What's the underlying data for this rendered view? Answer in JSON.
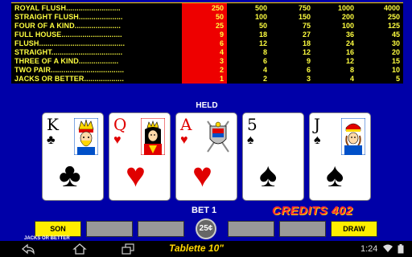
{
  "paytable": {
    "hands": [
      "ROYAL FLUSH",
      "STRAIGHT FLUSH",
      "FOUR OF A KIND",
      "FULL HOUSE",
      "FLUSH",
      "STRAIGHT",
      "THREE OF A KIND",
      "TWO PAIR",
      "JACKS OR BETTER"
    ],
    "dotted_names": [
      "ROYAL FLUSH..........................",
      "STRAIGHT FLUSH.....................",
      "FOUR OF A KIND......................",
      "FULL HOUSE.............................",
      "FLUSH.........................................",
      "STRAIGHT..................................",
      "THREE OF A KIND...................",
      "TWO PAIR...................................",
      "JACKS OR BETTER..................."
    ],
    "columns": [
      {
        "values": [
          "250",
          "50",
          "25",
          "9",
          "6",
          "4",
          "3",
          "2",
          "1"
        ],
        "highlighted": true
      },
      {
        "values": [
          "500",
          "100",
          "50",
          "18",
          "12",
          "8",
          "6",
          "4",
          "2"
        ],
        "highlighted": false
      },
      {
        "values": [
          "750",
          "150",
          "75",
          "27",
          "18",
          "12",
          "9",
          "6",
          "3"
        ],
        "highlighted": false
      },
      {
        "values": [
          "1000",
          "200",
          "100",
          "36",
          "24",
          "16",
          "12",
          "8",
          "4"
        ],
        "highlighted": false
      },
      {
        "values": [
          "4000",
          "250",
          "125",
          "45",
          "30",
          "20",
          "15",
          "10",
          "5"
        ],
        "highlighted": false
      }
    ],
    "highlight_color": "#ee0000",
    "text_color": "#ffff40"
  },
  "held_label": "HELD",
  "cards": [
    {
      "rank": "K",
      "suit": "♣",
      "suit_name": "clubs",
      "color": "black",
      "face": "king",
      "held": false
    },
    {
      "rank": "Q",
      "suit": "♥",
      "suit_name": "hearts",
      "color": "red",
      "face": "queen",
      "held": false
    },
    {
      "rank": "A",
      "suit": "♥",
      "suit_name": "hearts",
      "color": "red",
      "face": "ace-crest",
      "held": true
    },
    {
      "rank": "5",
      "suit": "♠",
      "suit_name": "spades",
      "color": "black",
      "face": "",
      "held": false
    },
    {
      "rank": "J",
      "suit": "♠",
      "suit_name": "spades",
      "color": "black",
      "face": "jack",
      "held": false
    }
  ],
  "bet_label": "BET 1",
  "credits_label": "CREDITS 402",
  "buttons": {
    "son": "SON",
    "draw": "DRAW",
    "coin": "25¢"
  },
  "game_caption": "JACKS OR BETTER",
  "navbar": {
    "tablet_label": "Tablette 10\"",
    "clock": "1:24",
    "icons": [
      "back-icon",
      "home-icon",
      "recent-apps-icon",
      "wifi-icon",
      "battery-icon"
    ]
  },
  "background_color": "#0000a8"
}
